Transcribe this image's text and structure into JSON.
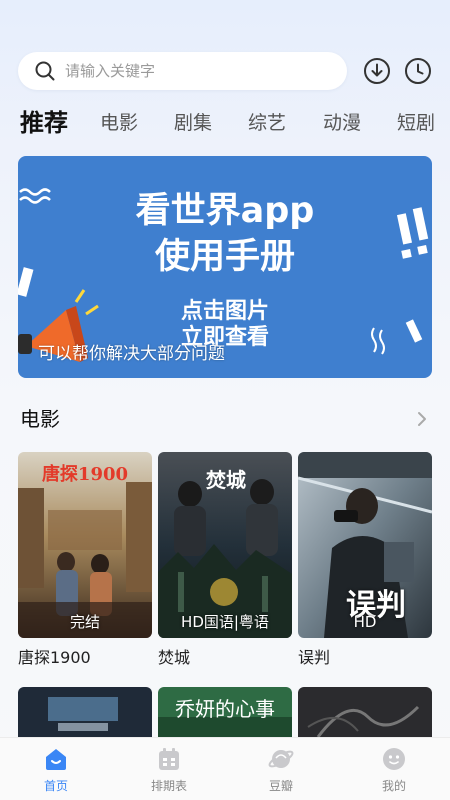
{
  "search": {
    "placeholder": "请输入关键字"
  },
  "tabs": [
    {
      "label": "推荐"
    },
    {
      "label": "电影"
    },
    {
      "label": "剧集"
    },
    {
      "label": "综艺"
    },
    {
      "label": "动漫"
    },
    {
      "label": "短剧"
    }
  ],
  "banner": {
    "title_line1": "看世界app",
    "title_line2": "使用手册",
    "sub_line1": "点击图片",
    "sub_line2": "立即查看",
    "caption": "可以帮你解决大部分问题",
    "color": "#3f7fcf"
  },
  "section": {
    "title": "电影"
  },
  "movies": [
    {
      "name": "唐探1900",
      "badge": "完结",
      "poster_text": "唐探1900"
    },
    {
      "name": "焚城",
      "badge": "HD国语|粤语",
      "poster_text": "焚城"
    },
    {
      "name": "误判",
      "badge": "HD",
      "poster_text": "误判"
    }
  ],
  "row2_posters": [
    {
      "poster_text": ""
    },
    {
      "poster_text": "乔妍的心事"
    },
    {
      "poster_text": ""
    }
  ],
  "nav": [
    {
      "label": "首页",
      "icon": "home-icon"
    },
    {
      "label": "排期表",
      "icon": "calendar-icon"
    },
    {
      "label": "豆瓣",
      "icon": "planet-icon"
    },
    {
      "label": "我的",
      "icon": "profile-icon"
    }
  ],
  "colors": {
    "accent": "#3a86f5",
    "banner": "#3f7fcf"
  }
}
